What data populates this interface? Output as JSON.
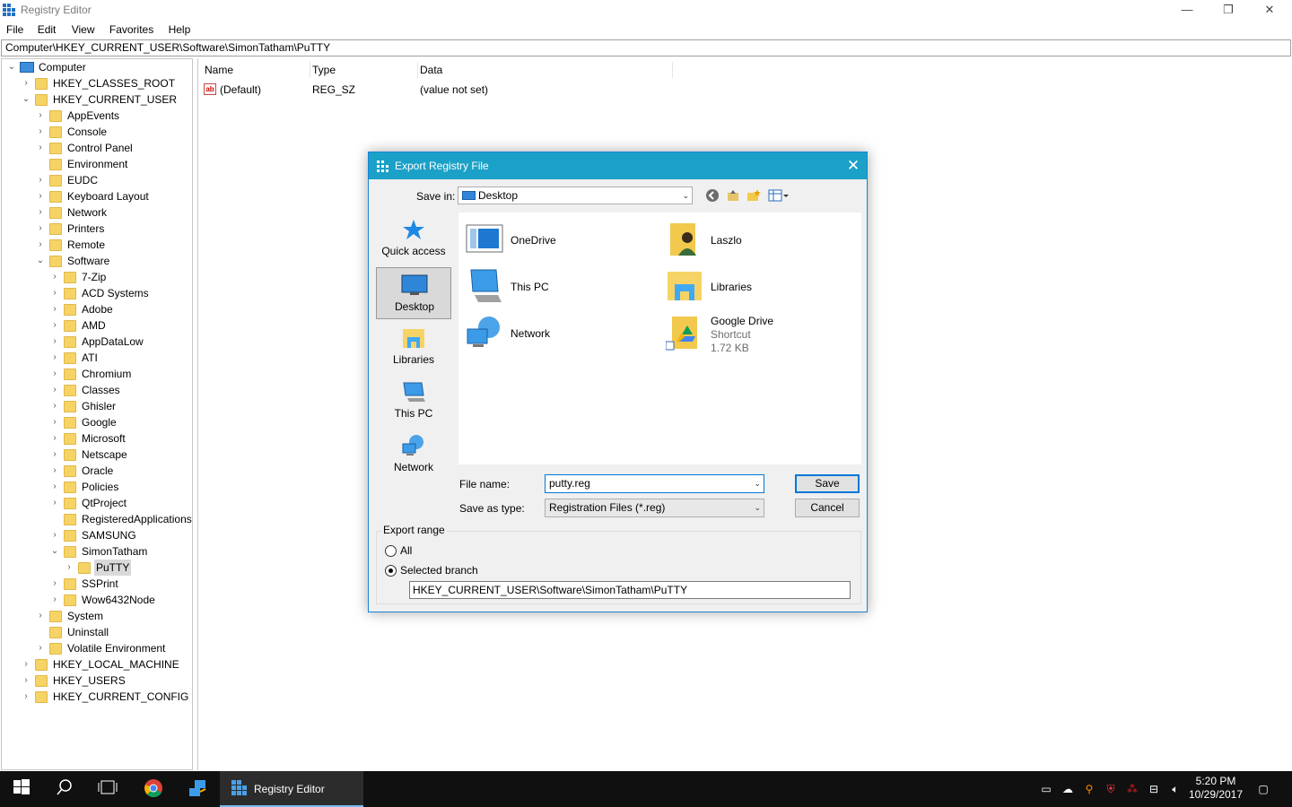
{
  "window": {
    "title": "Registry Editor",
    "min": "—",
    "max": "❐",
    "close": "✕"
  },
  "menu": [
    "File",
    "Edit",
    "View",
    "Favorites",
    "Help"
  ],
  "address": "Computer\\HKEY_CURRENT_USER\\Software\\SimonTatham\\PuTTY",
  "tree": {
    "root": "Computer",
    "hives": {
      "classes_root": "HKEY_CLASSES_ROOT",
      "current_user": "HKEY_CURRENT_USER",
      "local_machine": "HKEY_LOCAL_MACHINE",
      "users": "HKEY_USERS",
      "current_config": "HKEY_CURRENT_CONFIG"
    },
    "hkcu_children": [
      "AppEvents",
      "Console",
      "Control Panel",
      "Environment",
      "EUDC",
      "Keyboard Layout",
      "Network",
      "Printers",
      "Remote",
      "Software"
    ],
    "software_children": [
      "7-Zip",
      "ACD Systems",
      "Adobe",
      "AMD",
      "AppDataLow",
      "ATI",
      "Chromium",
      "Classes",
      "Ghisler",
      "Google",
      "Microsoft",
      "Netscape",
      "Oracle",
      "Policies",
      "QtProject",
      "RegisteredApplications",
      "SAMSUNG",
      "SimonTatham"
    ],
    "simontatham_children": [
      "PuTTY"
    ],
    "software_after": [
      "SSPrint",
      "Wow6432Node"
    ],
    "hkcu_after": [
      "System",
      "Uninstall",
      "Volatile Environment"
    ]
  },
  "list": {
    "headers": {
      "name": "Name",
      "type": "Type",
      "data": "Data"
    },
    "rows": [
      {
        "name": "(Default)",
        "type": "REG_SZ",
        "data": "(value not set)"
      }
    ]
  },
  "dialog": {
    "title": "Export Registry File",
    "close": "✕",
    "save_in_label": "Save in:",
    "save_in_value": "Desktop",
    "places": [
      "Quick access",
      "Desktop",
      "Libraries",
      "This PC",
      "Network"
    ],
    "items": [
      {
        "name": "OneDrive"
      },
      {
        "name": "Laszlo"
      },
      {
        "name": "This PC"
      },
      {
        "name": "Libraries"
      },
      {
        "name": "Network"
      },
      {
        "name": "Google Drive",
        "sub1": "Shortcut",
        "sub2": "1.72 KB"
      }
    ],
    "file_name_label": "File name:",
    "file_name_value": "putty.reg",
    "save_as_type_label": "Save as type:",
    "save_as_type_value": "Registration Files (*.reg)",
    "save_button": "Save",
    "cancel_button": "Cancel",
    "export_range_label": "Export range",
    "radio_all": "All",
    "radio_selected": "Selected branch",
    "selected_branch": "checked",
    "branch_value": "HKEY_CURRENT_USER\\Software\\SimonTatham\\PuTTY"
  },
  "taskbar": {
    "app_label": "Registry Editor",
    "time": "5:20 PM",
    "date": "10/29/2017"
  }
}
